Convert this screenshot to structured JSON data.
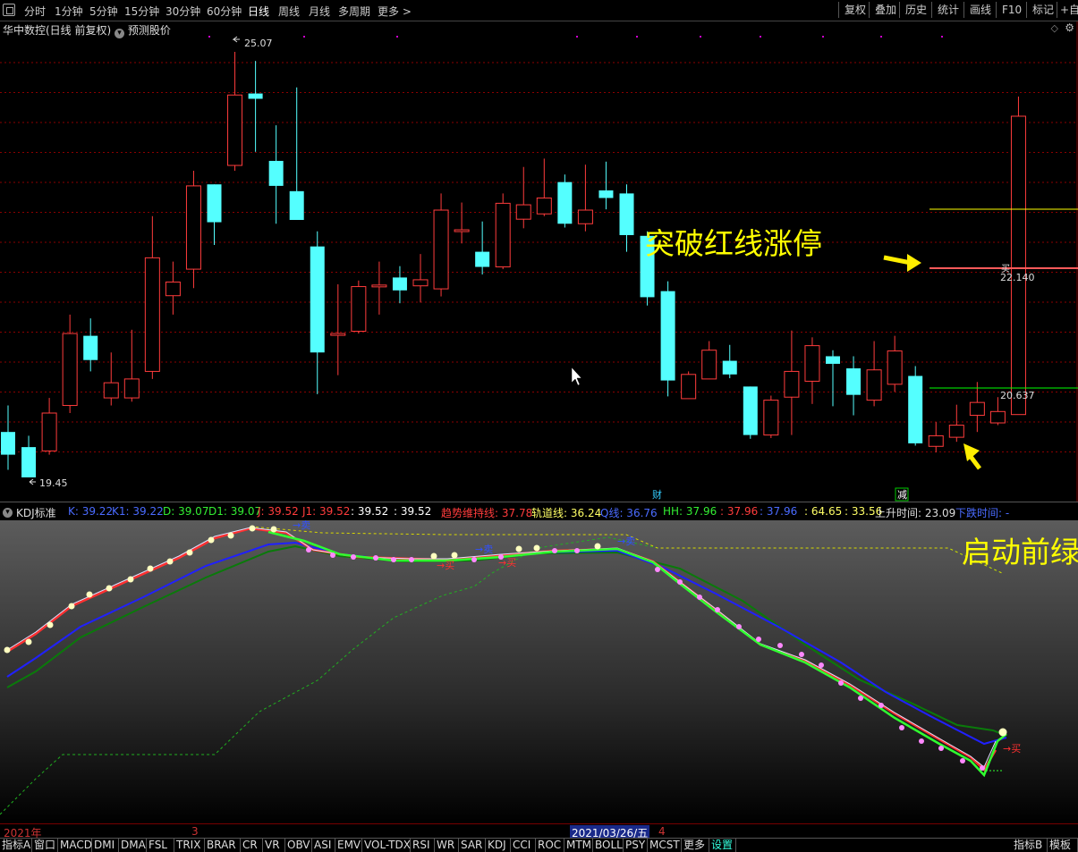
{
  "toolbar": {
    "periods": [
      "分时",
      "1分钟",
      "5分钟",
      "15分钟",
      "30分钟",
      "60分钟",
      "日线",
      "周线",
      "月线",
      "多周期",
      "更多 >"
    ],
    "active_period": "日线",
    "right_buttons": [
      "复权",
      "叠加",
      "历史",
      "统计",
      "画线",
      "F10",
      "标记",
      "+自"
    ]
  },
  "price_chart": {
    "title": "华中数控(日线 前复权)",
    "forecast_label": "预测股价",
    "high_label": "25.07",
    "low_label": "19.45",
    "upper_line_label": "22.140",
    "lower_line_label": "20.637",
    "buy_marker": "买",
    "annotation_main": "突破红线涨停",
    "event_marks": [
      "财",
      "减"
    ],
    "colors": {
      "up": "#ff3c3c",
      "down": "#54ffff",
      "grid": "#8b0000",
      "yellow_line": "#ffff00",
      "green_line": "#00ff00",
      "annotation": "#ffff00"
    }
  },
  "chart_data": {
    "type": "candlestick",
    "title": "华中数控(日线 前复权)",
    "high": 25.07,
    "low": 19.45,
    "reference_lines": [
      22.14,
      20.637
    ],
    "candles": [
      {
        "o": 20.05,
        "c": 19.75,
        "h": 20.4,
        "l": 19.55
      },
      {
        "o": 19.85,
        "c": 19.45,
        "h": 20.0,
        "l": 19.45
      },
      {
        "o": 19.8,
        "c": 20.3,
        "h": 20.5,
        "l": 19.75
      },
      {
        "o": 20.4,
        "c": 21.35,
        "h": 21.6,
        "l": 20.3
      },
      {
        "o": 21.32,
        "c": 21.0,
        "h": 21.55,
        "l": 20.85
      },
      {
        "o": 20.5,
        "c": 20.7,
        "h": 21.1,
        "l": 20.4
      },
      {
        "o": 20.5,
        "c": 20.75,
        "h": 21.4,
        "l": 20.45
      },
      {
        "o": 20.85,
        "c": 22.35,
        "h": 22.9,
        "l": 20.75
      },
      {
        "o": 21.85,
        "c": 22.03,
        "h": 22.3,
        "l": 21.6
      },
      {
        "o": 22.2,
        "c": 23.3,
        "h": 23.5,
        "l": 21.95
      },
      {
        "o": 23.32,
        "c": 22.82,
        "h": 23.32,
        "l": 22.52
      },
      {
        "o": 23.57,
        "c": 24.5,
        "h": 25.07,
        "l": 23.5
      },
      {
        "o": 24.52,
        "c": 24.45,
        "h": 24.95,
        "l": 23.75
      },
      {
        "o": 23.63,
        "c": 23.3,
        "h": 24.1,
        "l": 22.8
      },
      {
        "o": 23.23,
        "c": 22.85,
        "h": 24.6,
        "l": 22.85
      },
      {
        "o": 22.5,
        "c": 21.1,
        "h": 22.7,
        "l": 20.55
      },
      {
        "o": 21.35,
        "c": 21.35,
        "h": 22.0,
        "l": 20.8
      },
      {
        "o": 21.38,
        "c": 21.97,
        "h": 22.05,
        "l": 21.35
      },
      {
        "o": 21.99,
        "c": 21.99,
        "h": 22.3,
        "l": 21.6
      },
      {
        "o": 22.09,
        "c": 21.92,
        "h": 22.24,
        "l": 21.75
      },
      {
        "o": 21.98,
        "c": 22.06,
        "h": 22.4,
        "l": 21.76
      },
      {
        "o": 21.94,
        "c": 22.98,
        "h": 23.2,
        "l": 21.84
      },
      {
        "o": 22.72,
        "c": 22.72,
        "h": 23.08,
        "l": 22.54
      },
      {
        "o": 22.43,
        "c": 22.23,
        "h": 22.83,
        "l": 22.13
      },
      {
        "o": 22.23,
        "c": 23.07,
        "h": 23.2,
        "l": 22.2
      },
      {
        "o": 22.86,
        "c": 23.05,
        "h": 23.55,
        "l": 22.74
      },
      {
        "o": 22.93,
        "c": 23.14,
        "h": 23.66,
        "l": 22.9
      },
      {
        "o": 23.35,
        "c": 22.8,
        "h": 23.45,
        "l": 22.75
      },
      {
        "o": 22.8,
        "c": 22.98,
        "h": 23.58,
        "l": 22.7
      },
      {
        "o": 23.24,
        "c": 23.14,
        "h": 23.62,
        "l": 22.99
      },
      {
        "o": 23.2,
        "c": 22.65,
        "h": 23.32,
        "l": 22.43
      },
      {
        "o": 22.64,
        "c": 21.83,
        "h": 22.7,
        "l": 21.72
      },
      {
        "o": 21.91,
        "c": 20.73,
        "h": 22.04,
        "l": 20.52
      },
      {
        "o": 20.49,
        "c": 20.81,
        "h": 20.85,
        "l": 20.49
      },
      {
        "o": 20.75,
        "c": 21.13,
        "h": 21.25,
        "l": 20.75
      },
      {
        "o": 20.99,
        "c": 20.81,
        "h": 21.2,
        "l": 20.76
      },
      {
        "o": 20.65,
        "c": 20.01,
        "h": 20.65,
        "l": 19.96
      },
      {
        "o": 20.01,
        "c": 20.47,
        "h": 20.53,
        "l": 19.97
      },
      {
        "o": 20.51,
        "c": 20.85,
        "h": 21.39,
        "l": 20.01
      },
      {
        "o": 20.72,
        "c": 21.19,
        "h": 21.3,
        "l": 20.42
      },
      {
        "o": 21.05,
        "c": 20.95,
        "h": 21.13,
        "l": 20.39
      },
      {
        "o": 20.89,
        "c": 20.54,
        "h": 21.05,
        "l": 20.27
      },
      {
        "o": 20.47,
        "c": 20.87,
        "h": 21.25,
        "l": 20.39
      },
      {
        "o": 20.68,
        "c": 21.12,
        "h": 21.32,
        "l": 20.58
      },
      {
        "o": 20.79,
        "c": 19.9,
        "h": 20.92,
        "l": 19.87
      },
      {
        "o": 19.86,
        "c": 20.0,
        "h": 20.18,
        "l": 19.78
      },
      {
        "o": 19.98,
        "c": 20.14,
        "h": 20.41,
        "l": 19.92
      },
      {
        "o": 20.27,
        "c": 20.44,
        "h": 20.71,
        "l": 20.05
      },
      {
        "o": 20.17,
        "c": 20.32,
        "h": 20.51,
        "l": 20.14
      },
      {
        "o": 20.28,
        "c": 24.22,
        "h": 24.48,
        "l": 20.28
      }
    ]
  },
  "indicator": {
    "name": "KDJ标准",
    "items": [
      {
        "label": "K: 39.22",
        "color": "#4a6bff"
      },
      {
        "label": "K1: 39.22",
        "color": "#4a6bff"
      },
      {
        "label": "D: 39.07",
        "color": "#33ee33"
      },
      {
        "label": "D1: 39.07",
        "color": "#33ee33"
      },
      {
        "label": "J: 39.52",
        "color": "#ff3c3c"
      },
      {
        "label": "J1: 39.52",
        "color": "#ff3c3c"
      },
      {
        "label": ": 39.52",
        "color": "#ffffff"
      },
      {
        "label": ": 39.52",
        "color": "#ffffff"
      },
      {
        "label": "趋势维持线: 37.78",
        "color": "#ff3c3c"
      },
      {
        "label": "轨道线: 36.24",
        "color": "#ffff66"
      },
      {
        "label": "Q线: 36.76",
        "color": "#4a6bff"
      },
      {
        "label": "HH: 37.96",
        "color": "#33ee33"
      },
      {
        "label": ": 37.96",
        "color": "#ff3c3c"
      },
      {
        "label": ": 37.96",
        "color": "#4a6bff"
      },
      {
        "label": ": 64.65",
        "color": "#ffff66"
      },
      {
        "label": ": 33.56",
        "color": "#ffff66"
      },
      {
        "label": "上升时间: 23.09",
        "color": "#dddddd"
      },
      {
        "label": "下跌时间: -",
        "color": "#4a6bff"
      }
    ],
    "annotation": "启动前绿",
    "signal_sell": "→卖",
    "signal_buy": "→买"
  },
  "date_axis": {
    "year_label": "2021年",
    "month_3": "3",
    "month_4": "4",
    "cursor_date": "2021/03/26/五"
  },
  "bottom_tabs": [
    "指标A",
    "窗口",
    "MACD",
    "DMI",
    "DMA",
    "FSL",
    "TRIX",
    "BRAR",
    "CR",
    "VR",
    "OBV",
    "ASI",
    "EMV",
    "VOL-TDX",
    "RSI",
    "WR",
    "SAR",
    "KDJ",
    "CCI",
    "ROC",
    "MTM",
    "BOLL",
    "PSY",
    "MCST",
    "更多",
    "设置",
    "指标B",
    "模板"
  ]
}
